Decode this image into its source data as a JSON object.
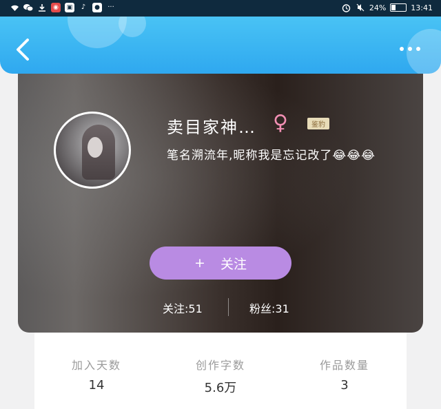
{
  "status_bar": {
    "left_icons": [
      "wifi-icon",
      "wechat-icon",
      "download-icon",
      "app-icon-1",
      "app-icon-2",
      "tiktok-icon",
      "app-icon-3",
      "more-dots-icon"
    ],
    "battery": "24%",
    "battery_level": 0.24,
    "time": "13:41"
  },
  "header": {
    "back_icon": "chevron-left-icon",
    "more_icon": "more-dots-icon",
    "color": "#3bb6f2"
  },
  "profile": {
    "nickname": "卖目家神…",
    "gender_symbol": "♀",
    "tag": "鉴豹",
    "bio": "笔名溯流年,昵称我是忘记改了😂😂😂",
    "follow_button_plus": "+",
    "follow_button_label": "关注",
    "following_label": "关注:51",
    "fans_label": "粉丝:31",
    "accent": "#b98be3"
  },
  "info": [
    {
      "label": "加入天数",
      "value": "14"
    },
    {
      "label": "创作字数",
      "value": "5.6万"
    },
    {
      "label": "作品数量",
      "value": "3"
    }
  ]
}
